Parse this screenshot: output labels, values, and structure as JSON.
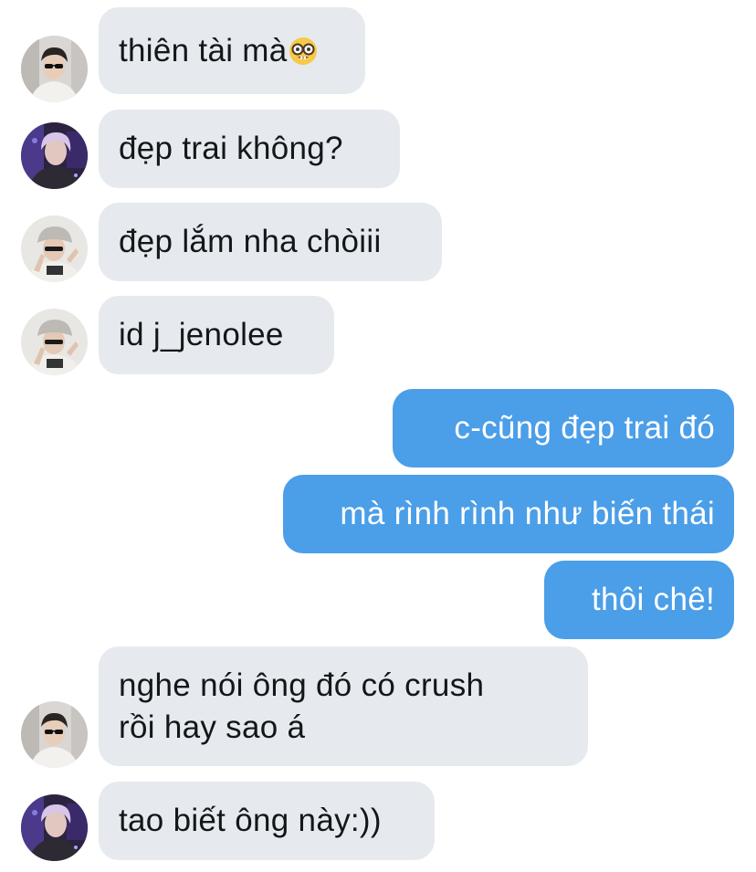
{
  "conversation": {
    "messages": [
      {
        "sender": "other",
        "avatar": "avatar-dark-sunglasses",
        "text": "thiên tài mà",
        "emoji": "nerd-face-emoji"
      },
      {
        "sender": "other",
        "avatar": "avatar-purple-hair",
        "text": "đẹp trai không?"
      },
      {
        "sender": "other",
        "avatar": "avatar-cap-peace",
        "text": "đẹp lắm nha chòiii"
      },
      {
        "sender": "other",
        "avatar": "avatar-cap-peace",
        "text": "id j_jenolee"
      },
      {
        "sender": "me",
        "text": "c-cũng đẹp trai đó"
      },
      {
        "sender": "me",
        "text": "mà rình rình như biến thái"
      },
      {
        "sender": "me",
        "text": "thôi chê!"
      },
      {
        "sender": "other",
        "avatar": "avatar-dark-sunglasses",
        "lines": [
          "nghe nói ông đó có crush",
          "rồi hay sao á"
        ]
      },
      {
        "sender": "other",
        "avatar": "avatar-purple-hair",
        "text": "tao biết ông này:))"
      }
    ]
  },
  "colors": {
    "incoming_bubble": "#e6eaef",
    "outgoing_bubble": "#4b9ee8",
    "incoming_text": "#14171a",
    "outgoing_text": "#ffffff"
  }
}
